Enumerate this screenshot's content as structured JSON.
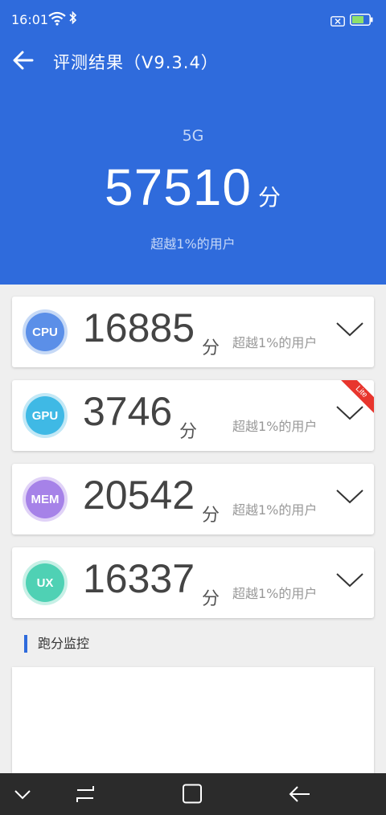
{
  "status": {
    "time": "16:01"
  },
  "appbar": {
    "title": "评测结果（V9.3.4）"
  },
  "summary": {
    "model": "5G",
    "total_score": "57510",
    "unit": "分",
    "percentile": "超越1%的用户"
  },
  "categories": [
    {
      "code": "CPU",
      "score": "16885",
      "unit": "分",
      "percentile": "超越1%的用户",
      "color": "#5b8fe8",
      "ring": "#c6d9f6"
    },
    {
      "code": "GPU",
      "score": "3746",
      "unit": "分",
      "percentile": "超越1%的用户",
      "color": "#3fb9e5",
      "ring": "#c2e8f6",
      "tag": "Lite"
    },
    {
      "code": "MEM",
      "score": "20542",
      "unit": "分",
      "percentile": "超越1%的用户",
      "color": "#a682e8",
      "ring": "#e0d2f7"
    },
    {
      "code": "UX",
      "score": "16337",
      "unit": "分",
      "percentile": "超越1%的用户",
      "color": "#4fd1b4",
      "ring": "#c7f0e6"
    }
  ],
  "monitor": {
    "title": "跑分监控"
  },
  "colors": {
    "primary": "#2f6bdc",
    "lite_tag": "#e8352d"
  }
}
